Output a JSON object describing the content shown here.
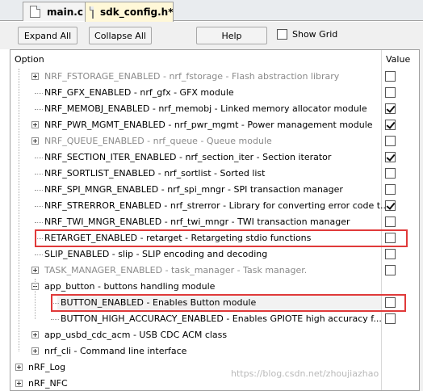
{
  "tabs": [
    {
      "label": "main.c",
      "active": false
    },
    {
      "label": "sdk_config.h*",
      "active": true
    }
  ],
  "toolbar": {
    "expand_all": "Expand All",
    "collapse_all": "Collapse All",
    "help": "Help",
    "show_grid": "Show Grid",
    "show_grid_checked": false
  },
  "header": {
    "option": "Option",
    "value": "Value"
  },
  "rows": [
    {
      "label": "NRF_FSTORAGE_ENABLED - nrf_fstorage - Flash abstraction library",
      "checked": false,
      "disabled": true,
      "expander": "plus"
    },
    {
      "label": "NRF_GFX_ENABLED  - nrf_gfx - GFX module",
      "checked": false,
      "disabled": false,
      "expander": "none"
    },
    {
      "label": "NRF_MEMOBJ_ENABLED  - nrf_memobj - Linked memory allocator module",
      "checked": true,
      "disabled": false,
      "expander": "none"
    },
    {
      "label": "NRF_PWR_MGMT_ENABLED - nrf_pwr_mgmt - Power management module",
      "checked": true,
      "disabled": false,
      "expander": "plus"
    },
    {
      "label": "NRF_QUEUE_ENABLED - nrf_queue - Queue module",
      "checked": false,
      "disabled": true,
      "expander": "plus"
    },
    {
      "label": "NRF_SECTION_ITER_ENABLED  - nrf_section_iter - Section iterator",
      "checked": true,
      "disabled": false,
      "expander": "none"
    },
    {
      "label": "NRF_SORTLIST_ENABLED  - nrf_sortlist - Sorted list",
      "checked": false,
      "disabled": false,
      "expander": "none"
    },
    {
      "label": "NRF_SPI_MNGR_ENABLED  - nrf_spi_mngr - SPI transaction manager",
      "checked": false,
      "disabled": false,
      "expander": "none"
    },
    {
      "label": "NRF_STRERROR_ENABLED  - nrf_strerror - Library for converting error code t...",
      "checked": true,
      "disabled": false,
      "expander": "none"
    },
    {
      "label": "NRF_TWI_MNGR_ENABLED  - nrf_twi_mngr - TWI transaction manager",
      "checked": false,
      "disabled": false,
      "expander": "none"
    },
    {
      "label": "RETARGET_ENABLED  - retarget - Retargeting stdio functions",
      "checked": false,
      "disabled": false,
      "expander": "none",
      "highlighted": true
    },
    {
      "label": "SLIP_ENABLED  - slip - SLIP encoding and decoding",
      "checked": false,
      "disabled": false,
      "expander": "none"
    },
    {
      "label": "TASK_MANAGER_ENABLED - task_manager - Task manager.",
      "checked": false,
      "disabled": true,
      "expander": "plus"
    },
    {
      "label": "app_button - buttons handling module",
      "checked": null,
      "disabled": false,
      "expander": "minus"
    },
    {
      "label": "BUTTON_ENABLED  - Enables Button module",
      "checked": false,
      "disabled": false,
      "expander": "none",
      "highlighted": true,
      "selected": true
    },
    {
      "label": "BUTTON_HIGH_ACCURACY_ENABLED  - Enables GPIOTE high accuracy f...",
      "checked": false,
      "disabled": false,
      "expander": "none"
    },
    {
      "label": "app_usbd_cdc_acm - USB CDC ACM class",
      "checked": null,
      "disabled": false,
      "expander": "plus"
    },
    {
      "label": "nrf_cli - Command line interface",
      "checked": null,
      "disabled": false,
      "expander": "plus"
    },
    {
      "label": "nRF_Log",
      "checked": null,
      "disabled": false,
      "expander": "plus"
    },
    {
      "label": "nRF_NFC",
      "checked": null,
      "disabled": false,
      "expander": "plus"
    }
  ],
  "watermark": "https://blog.csdn.net/zhoujiazhao",
  "colors": {
    "highlight_border": "#e03a3a",
    "active_tab": "#fff8d8",
    "disabled_text": "#8a8a8a"
  }
}
